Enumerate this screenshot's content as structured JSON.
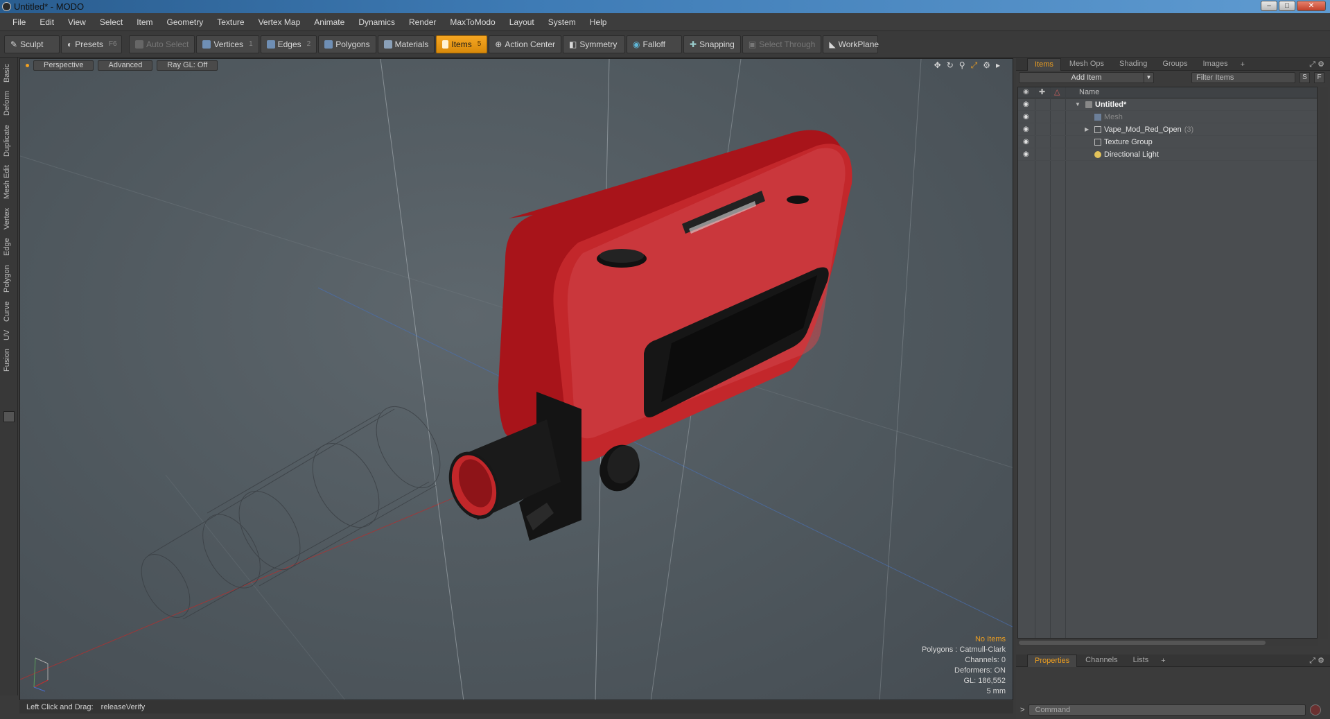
{
  "window": {
    "title": "Untitled* - MODO"
  },
  "menu": [
    "File",
    "Edit",
    "View",
    "Select",
    "Item",
    "Geometry",
    "Texture",
    "Vertex Map",
    "Animate",
    "Dynamics",
    "Render",
    "MaxToModo",
    "Layout",
    "System",
    "Help"
  ],
  "toolbar": {
    "sculpt": "Sculpt",
    "presets": "Presets",
    "presets_key": "F6",
    "auto_select": "Auto Select",
    "vertices": "Vertices",
    "vertices_num": "1",
    "edges": "Edges",
    "edges_num": "2",
    "polygons": "Polygons",
    "materials": "Materials",
    "items": "Items",
    "items_num": "5",
    "action_center": "Action Center",
    "symmetry": "Symmetry",
    "falloff": "Falloff",
    "snapping": "Snapping",
    "select_through": "Select Through",
    "workplane": "WorkPlane"
  },
  "left_tabs": [
    "Basic",
    "Deform",
    "Duplicate",
    "Mesh Edit",
    "Vertex",
    "Edge",
    "Polygon",
    "Curve",
    "UV",
    "Fusion"
  ],
  "viewport": {
    "view": "Perspective",
    "shading": "Advanced",
    "raygl": "Ray GL: Off",
    "info": {
      "selection": "No Items",
      "polygons": "Polygons : Catmull-Clark",
      "channels": "Channels: 0",
      "deformers": "Deformers: ON",
      "gl": "GL: 186,552",
      "scale": "5 mm"
    }
  },
  "status": {
    "hint": "Left Click and Drag:",
    "value": "releaseVerify"
  },
  "right_panel": {
    "tabs": [
      "Items",
      "Mesh Ops",
      "Shading",
      "Groups",
      "Images"
    ],
    "add_item": "Add Item",
    "filter_placeholder": "Filter Items",
    "s_btn": "S",
    "f_btn": "F",
    "col_name": "Name",
    "tree": [
      {
        "label": "Untitled*",
        "kind": "scene"
      },
      {
        "label": "Mesh",
        "kind": "mesh"
      },
      {
        "label": "Vape_Mod_Red_Open",
        "count": "(3)",
        "kind": "group"
      },
      {
        "label": "Texture Group",
        "kind": "texture"
      },
      {
        "label": "Directional Light",
        "kind": "light"
      }
    ],
    "bottom_tabs": [
      "Properties",
      "Channels",
      "Lists"
    ],
    "command_placeholder": "Command",
    "command_prompt": ">"
  },
  "colors": {
    "accent": "#f0a020",
    "model_red": "#b8161b",
    "model_black": "#141414",
    "viewport_bg": "#58616a"
  }
}
